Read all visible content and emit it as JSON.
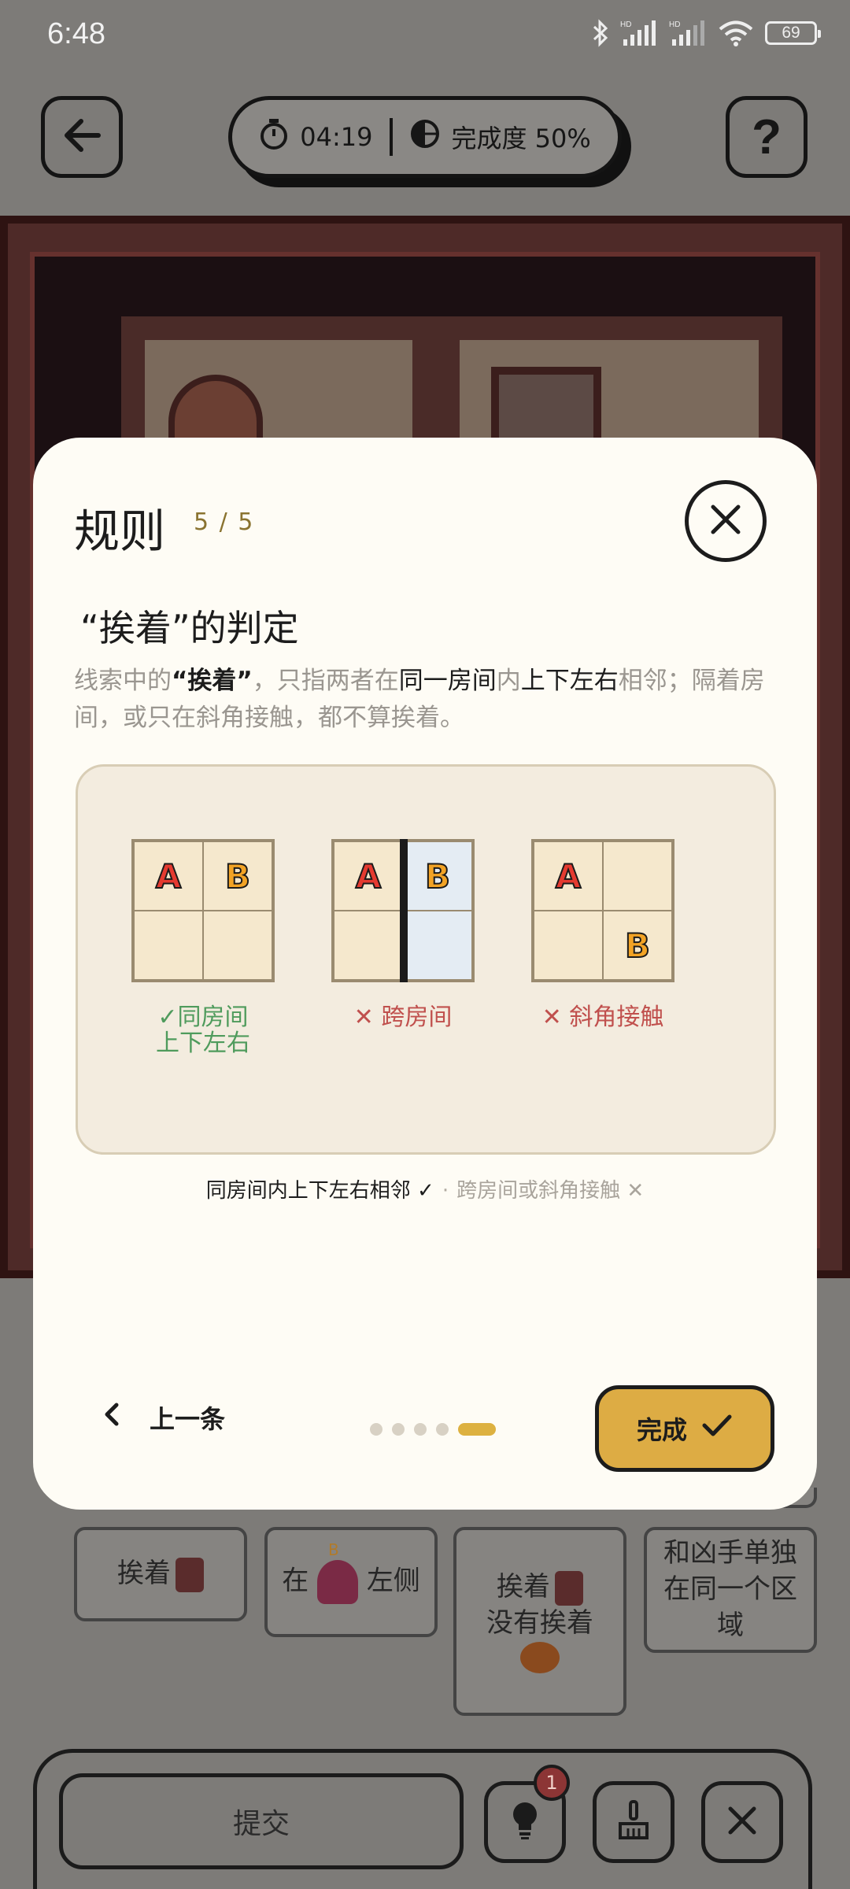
{
  "status_bar": {
    "time": "6:48",
    "battery": "69"
  },
  "top_bar": {
    "timer": "04:19",
    "progress_label": "完成度 50%",
    "help_label": "?"
  },
  "dialog": {
    "title": "规则",
    "counter": "5 / 5",
    "heading": "“挨着”的判定",
    "desc": [
      {
        "text": "线索中的",
        "style": "dim"
      },
      {
        "text": "“挨着”",
        "style": "strong"
      },
      {
        "text": "，只指两者在",
        "style": "dim"
      },
      {
        "text": "同一房间",
        "style": "em"
      },
      {
        "text": "内",
        "style": "dim"
      },
      {
        "text": "上下左右",
        "style": "em"
      },
      {
        "text": "相邻；隔着房间，或只在斜角接触，都不算挨着。",
        "style": "dim"
      }
    ],
    "examples": [
      {
        "caption_line1": "✓同房间",
        "caption_line2": "上下左右",
        "cells": [
          "A",
          "B",
          "",
          ""
        ]
      },
      {
        "caption_line1": "✕ 跨房间",
        "caption_line2": "",
        "cells": [
          "A",
          "B",
          "",
          ""
        ]
      },
      {
        "caption_line1": "✕ 斜角接触",
        "caption_line2": "",
        "cells": [
          "A",
          "",
          "",
          "B"
        ]
      }
    ],
    "summary_ok": "同房间内上下左右相邻 ✓",
    "summary_sep": "·",
    "summary_bad": "跨房间或斜角接触 ✕",
    "prev_label": "上一条",
    "done_label": "完成",
    "page_total": 5,
    "page_current": 5
  },
  "board": {
    "clue1": "挨着",
    "clue2_prefix": "在",
    "clue2_tag": "B",
    "clue2_suffix": "左侧",
    "clue3_line1": "挨着",
    "clue3_line2": "没有挨着",
    "clue4": "和凶手单独在同一个区域"
  },
  "bottom_bar": {
    "submit_label": "提交",
    "hint_count": "1"
  },
  "colors": {
    "accent": "#ddac44",
    "ok": "#4f9b5c",
    "bad": "#c0504d",
    "dialog_bg": "#fefcf5"
  }
}
